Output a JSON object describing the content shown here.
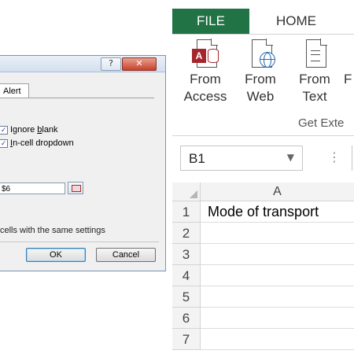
{
  "dialog": {
    "help_label": "?",
    "close_label": "✕",
    "tab_label": "Alert",
    "ignore_blank": {
      "pre": "Ignore ",
      "u": "b",
      "post": "lank",
      "checked": "✓"
    },
    "in_cell_dropdown": {
      "pre": "",
      "u": "I",
      "post": "n-cell dropdown",
      "checked": "✓"
    },
    "source_value": "$6",
    "apply_text": "cells with the same settings",
    "ok_label": "OK",
    "cancel_label": "Cancel"
  },
  "excel": {
    "tabs": {
      "file": "FILE",
      "home": "HOME"
    },
    "ribbon": {
      "from_access": {
        "line1": "From",
        "line2": "Access",
        "icon": "access-icon"
      },
      "from_web": {
        "line1": "From",
        "line2": "Web",
        "icon": "web-icon"
      },
      "from_text": {
        "line1": "From",
        "line2": "Text",
        "icon": "text-file-icon"
      },
      "next_partial": {
        "line1": "F",
        "line2": ""
      },
      "group_label": "Get Exte"
    },
    "name_box": {
      "value": "B1",
      "arrow": "▼"
    },
    "formula_dots": "⋮",
    "column_header": "A",
    "rows": [
      {
        "num": "1",
        "value": "Mode of transport"
      },
      {
        "num": "2",
        "value": ""
      },
      {
        "num": "3",
        "value": ""
      },
      {
        "num": "4",
        "value": ""
      },
      {
        "num": "5",
        "value": ""
      },
      {
        "num": "6",
        "value": ""
      },
      {
        "num": "7",
        "value": ""
      }
    ]
  },
  "colors": {
    "excel_green": "#217346",
    "access_red": "#a4262c",
    "dialog_bg": "#f0f0f0"
  }
}
